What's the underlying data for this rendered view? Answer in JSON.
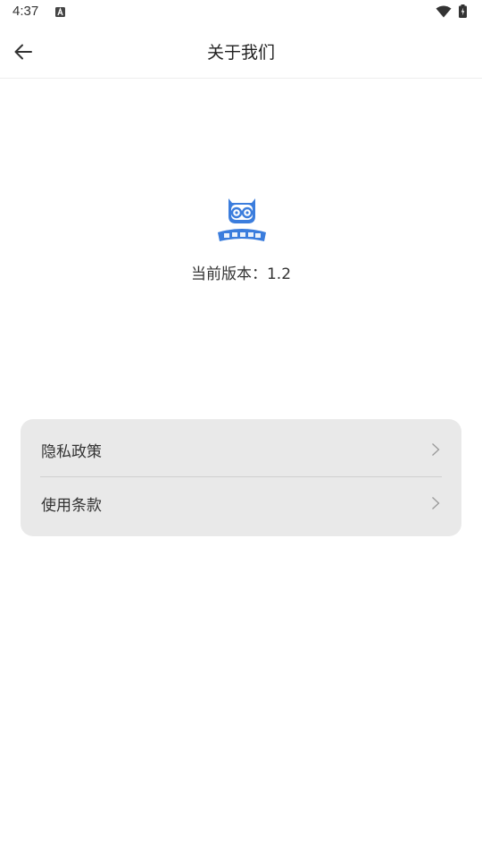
{
  "status_bar": {
    "time": "4:37",
    "icons": [
      "notification-a-icon",
      "wifi-icon",
      "battery-icon"
    ]
  },
  "header": {
    "title": "关于我们",
    "back_icon": "arrow-left-icon"
  },
  "app_info": {
    "logo_icon": "app-logo-icon",
    "version_label": "当前版本：",
    "version_value": "1.2"
  },
  "menu": {
    "items": [
      {
        "label": "隐私政策",
        "icon": "chevron-right-icon"
      },
      {
        "label": "使用条款",
        "icon": "chevron-right-icon"
      }
    ]
  },
  "colors": {
    "accent": "#3b7ddd",
    "card_background": "#e9e9e9",
    "divider": "#cfcfcf"
  }
}
